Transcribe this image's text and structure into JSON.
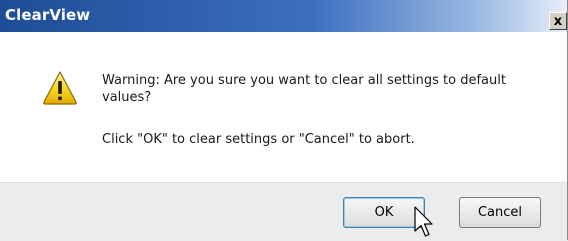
{
  "window": {
    "title": "ClearView",
    "close_glyph": "x"
  },
  "message": {
    "icon": "warning-icon",
    "line1": "Warning: Are you sure you want to clear all settings to default values?",
    "line2": "Click \"OK\" to clear settings or \"Cancel\" to abort."
  },
  "buttons": {
    "ok_label": "OK",
    "cancel_label": "Cancel"
  },
  "colors": {
    "titlebar_start": "#1f4c96",
    "titlebar_end": "#e8eef7",
    "warning_fill": "#f7d21c",
    "default_button_border": "#3c7fb1"
  }
}
